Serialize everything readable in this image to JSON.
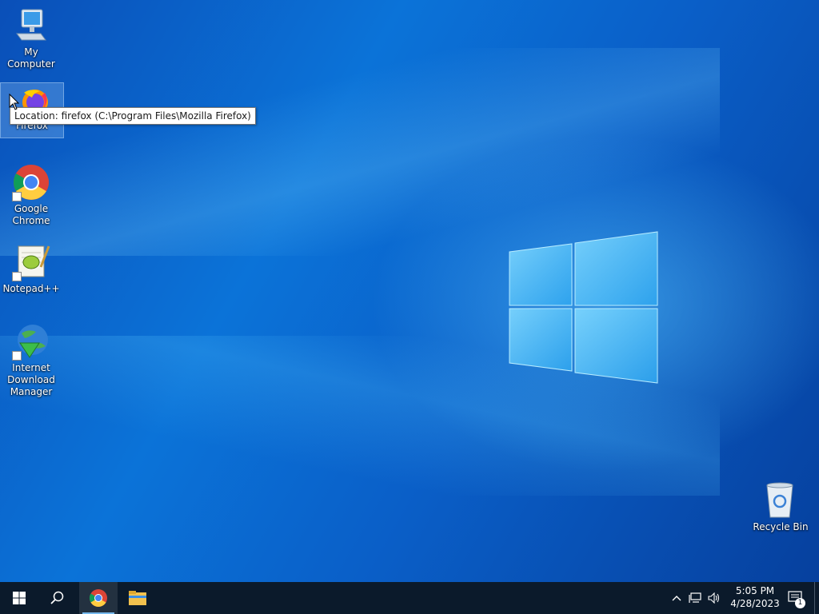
{
  "desktop": {
    "icons": [
      {
        "label": "My Computer"
      },
      {
        "label": "Firefox"
      },
      {
        "label": "Google Chrome"
      },
      {
        "label": "Notepad++"
      },
      {
        "label": "Internet Download Manager"
      },
      {
        "label": "Recycle Bin"
      }
    ],
    "tooltip": "Location: firefox (C:\\Program Files\\Mozilla Firefox)"
  },
  "taskbar": {
    "buttons": [
      {
        "icon": "windows-start-icon"
      },
      {
        "icon": "search-icon"
      },
      {
        "icon": "chrome-icon"
      },
      {
        "icon": "file-explorer-icon"
      }
    ],
    "tray": {
      "time": "5:05 PM",
      "date": "4/28/2023",
      "notification_count": "1"
    }
  },
  "colors": {
    "taskbar": "#0b1a2b",
    "desktop_blue": "#0b73d8",
    "tooltip_bg": "#ffffff"
  }
}
